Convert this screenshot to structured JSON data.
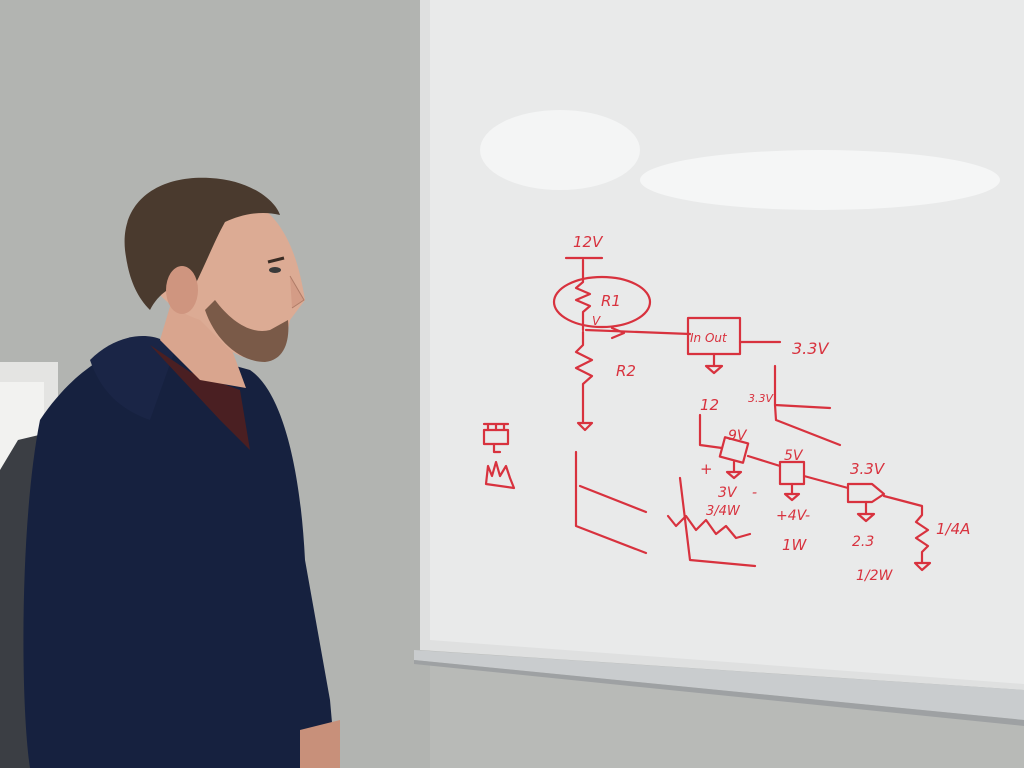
{
  "photo": {
    "colors": {
      "wall": "#b9bbb8",
      "whiteboard": "#e9eaea",
      "marker": "#d8323e",
      "hoodie": "#16213f",
      "skin": "#d9a58e",
      "hair": "#4a3a2e",
      "backpack": "#3b3e44",
      "tray": "#c9ccce"
    }
  },
  "whiteboard": {
    "labels": {
      "supply_12v": "12V",
      "r1": "R1",
      "v_tap": "V",
      "r2": "R2",
      "regulator_in_out": "In Out",
      "out_3v3": "3.3V",
      "small_3v3": "3.3V",
      "chain_12": "12",
      "stage1_v": "9V",
      "stage2_v": "5V",
      "stage3_v": "3.3V",
      "drop1": "3V",
      "power1": "3/4W",
      "drop2": "+4V-",
      "power2": "1W",
      "drop3": "2.3",
      "power3": "1/2W",
      "current": "1/4A",
      "plus_sign": "+",
      "minus_sign": "-"
    }
  }
}
